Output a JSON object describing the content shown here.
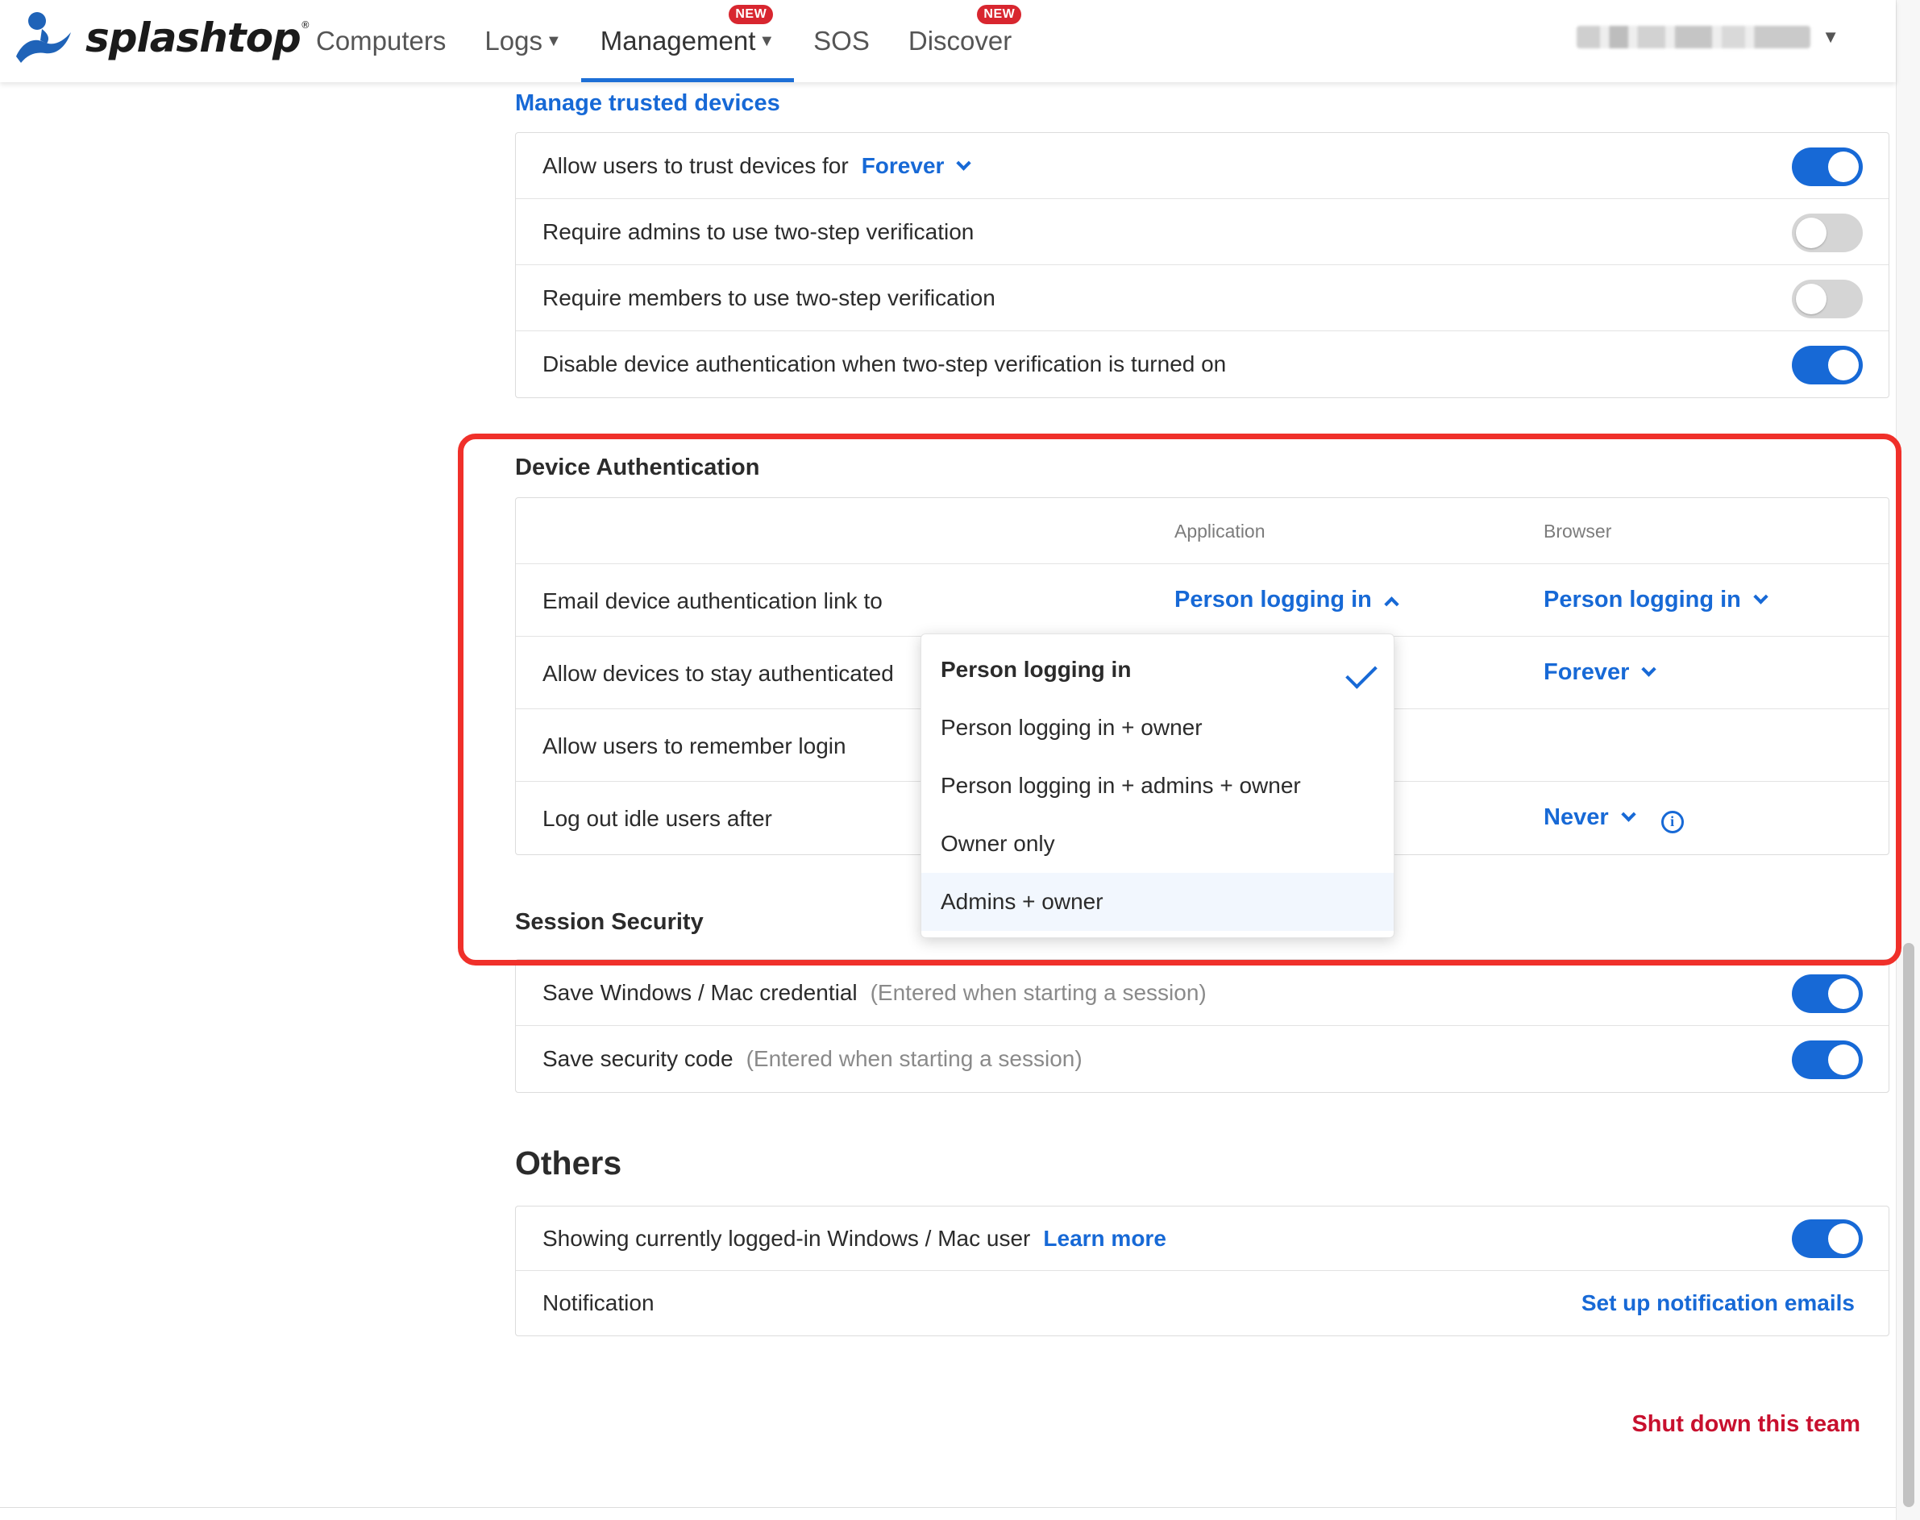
{
  "brand": {
    "name": "splashtop",
    "mark": "®"
  },
  "nav": {
    "items": [
      {
        "label": "Computers",
        "caret": false,
        "badge": ""
      },
      {
        "label": "Logs",
        "caret": true,
        "badge": ""
      },
      {
        "label": "Management",
        "caret": true,
        "badge": "NEW",
        "active": true
      },
      {
        "label": "SOS",
        "caret": false,
        "badge": ""
      },
      {
        "label": "Discover",
        "caret": false,
        "badge": "NEW"
      }
    ]
  },
  "two_step": {
    "manage_link": "Manage trusted devices",
    "rows": [
      {
        "label": "Allow users to trust devices for",
        "value": "Forever",
        "toggle": "on"
      },
      {
        "label": "Require admins to use two-step verification",
        "toggle": "off"
      },
      {
        "label": "Require members to use two-step verification",
        "toggle": "off"
      },
      {
        "label": "Disable device authentication when two-step verification is turned on",
        "toggle": "on"
      }
    ]
  },
  "device_auth": {
    "title": "Device Authentication",
    "col_application": "Application",
    "col_browser": "Browser",
    "rows": [
      {
        "label": "Email device authentication link to",
        "application": "Person logging in",
        "browser": "Person logging in"
      },
      {
        "label": "Allow devices to stay authenticated",
        "application": "",
        "browser": "Forever"
      },
      {
        "label": "Allow users to remember login",
        "application": "",
        "browser": ""
      },
      {
        "label": "Log out idle users after",
        "application": "",
        "browser": "Never"
      }
    ],
    "dropdown": {
      "options": [
        "Person logging in",
        "Person logging in + owner",
        "Person logging in + admins + owner",
        "Owner only",
        "Admins + owner"
      ],
      "selected": "Person logging in",
      "hovered": "Admins + owner"
    }
  },
  "session_security": {
    "title": "Session Security",
    "rows": [
      {
        "label": "Save Windows / Mac credential",
        "hint": "(Entered when starting a session)",
        "toggle": "on"
      },
      {
        "label": "Save security code",
        "hint": "(Entered when starting a session)",
        "toggle": "on"
      }
    ]
  },
  "others": {
    "title": "Others",
    "rows": [
      {
        "label": "Showing currently logged-in Windows / Mac user",
        "link": "Learn more",
        "toggle": "on"
      },
      {
        "label": "Notification",
        "link": "Set up notification emails"
      }
    ]
  },
  "footer": {
    "shutdown_link": "Shut down this team"
  },
  "colors": {
    "accent": "#1769d6",
    "highlight": "#f0302a",
    "danger": "#c8102e",
    "badge": "#d8262f"
  }
}
